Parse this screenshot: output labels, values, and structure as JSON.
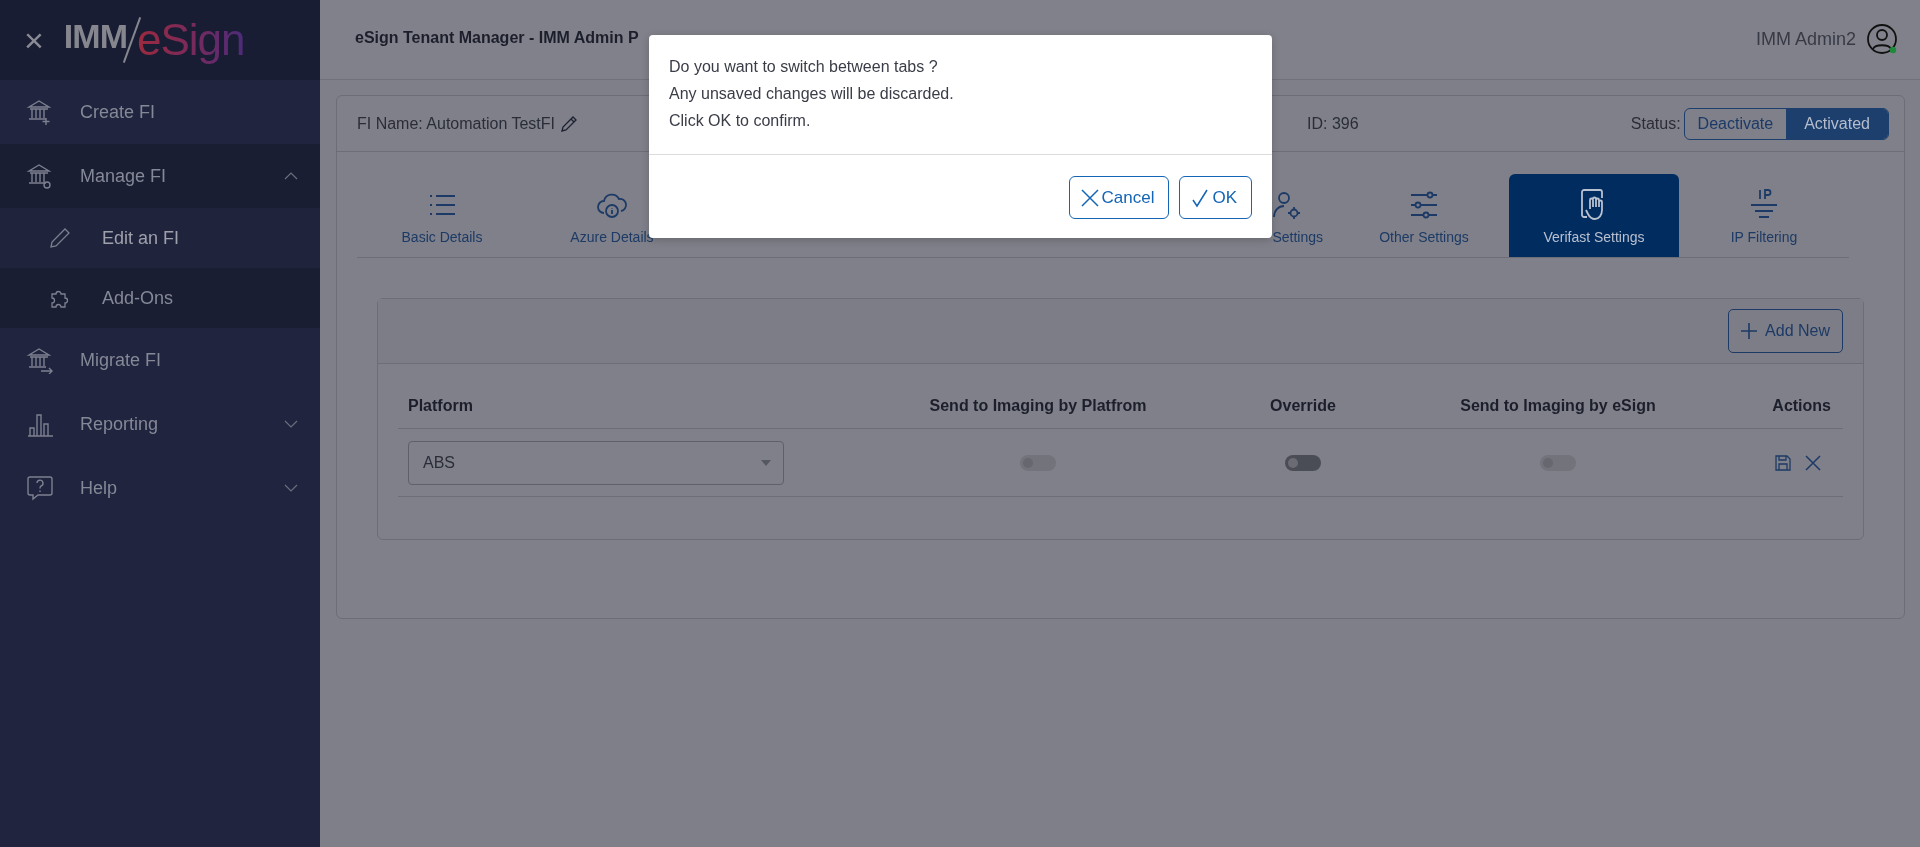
{
  "sidebar": {
    "close": "×",
    "logo": {
      "part_1": "IMM",
      "part_2": "eSign"
    },
    "items": [
      {
        "label": "Create FI",
        "kind": "link",
        "selected": false
      },
      {
        "label": "Manage FI",
        "kind": "group",
        "expanded": true,
        "children": [
          {
            "label": "Edit an FI",
            "selected": true
          },
          {
            "label": "Add-Ons",
            "selected": false
          }
        ]
      },
      {
        "label": "Migrate FI",
        "kind": "link",
        "selected": false
      },
      {
        "label": "Reporting",
        "kind": "group",
        "expanded": false
      },
      {
        "label": "Help",
        "kind": "group",
        "expanded": false
      }
    ]
  },
  "header": {
    "title": "eSign Tenant Manager - IMM Admin P",
    "user": "IMM Admin2"
  },
  "fi": {
    "name": "FI Name: Automation TestFI",
    "id": "ID: 396",
    "status_label": "Status:",
    "status_options": [
      {
        "label": "Deactivate",
        "selected": false
      },
      {
        "label": "Activated",
        "selected": true
      }
    ]
  },
  "tabs": [
    {
      "label": "Basic Details",
      "kind": "list",
      "selected": false,
      "clipped": false
    },
    {
      "label": "Azure Details",
      "kind": "cloud-info",
      "selected": false,
      "clipped": false
    },
    {
      "kind": "covered"
    },
    {
      "kind": "covered"
    },
    {
      "kind": "covered"
    },
    {
      "label": "Settings",
      "kind": "user-gear",
      "selected": false,
      "clipped": true
    },
    {
      "label": "Other Settings",
      "kind": "sliders",
      "selected": false,
      "clipped": false
    },
    {
      "label": "Verifast Settings",
      "kind": "hand",
      "selected": true,
      "clipped": false
    },
    {
      "label": "IP Filtering",
      "kind": "ip",
      "selected": false,
      "clipped": false
    }
  ],
  "table": {
    "add_button": "Add New",
    "columns": [
      "Platform",
      "Send to Imaging by Platfrom",
      "Override",
      "Send to Imaging by eSign",
      "Actions"
    ],
    "rows": [
      {
        "platform": "ABS",
        "toggles": [
          {
            "on": false,
            "disabled": true
          },
          {
            "on": false,
            "disabled": false
          },
          {
            "on": false,
            "disabled": true
          }
        ]
      }
    ]
  },
  "dialog": {
    "lines": [
      "Do you want to switch between tabs ?",
      "Any unsaved changes will be discarded.",
      "Click OK to confirm."
    ],
    "buttons": [
      {
        "label": "Cancel",
        "kind": "cancel"
      },
      {
        "label": "OK",
        "kind": "ok"
      }
    ]
  }
}
